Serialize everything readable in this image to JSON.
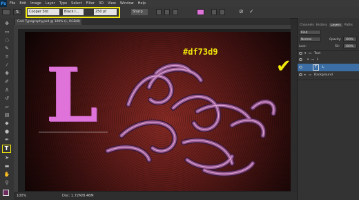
{
  "app": {
    "logo": "Ps"
  },
  "menu": [
    "File",
    "Edit",
    "Image",
    "Layer",
    "Type",
    "Select",
    "Filter",
    "3D",
    "View",
    "Window",
    "Help"
  ],
  "options": {
    "font_family": "Cooper Std",
    "font_style": "Black I...",
    "font_size": "250 pt",
    "antialias": "Sharp"
  },
  "document": {
    "tab_title": "Cool Typography.psd @ 100% (L, RGB/8) *",
    "canvas_letter": "L",
    "hex_annotation": "#df73d9",
    "text_color": "#df73d9"
  },
  "status": {
    "zoom": "100%",
    "doc_size": "Doc: 1.72M/8.46M"
  },
  "layers_panel": {
    "tabs": [
      "Channels",
      "History",
      "Layers",
      "Paths"
    ],
    "active_tab": "Layers",
    "filter": "Kind",
    "blend_mode": "Normal",
    "opacity_label": "Opacity:",
    "opacity": "100%",
    "lock_label": "Lock:",
    "fill_label": "Fill:",
    "fill": "100%",
    "layers": [
      {
        "name": "Text",
        "type": "group"
      },
      {
        "name": "L",
        "type": "group"
      },
      {
        "name": "L",
        "type": "text"
      },
      {
        "name": "Background",
        "type": "group"
      }
    ]
  },
  "colors": {
    "accent_yellow": "#f3e90a",
    "selection_blue": "#3a6ea5"
  }
}
